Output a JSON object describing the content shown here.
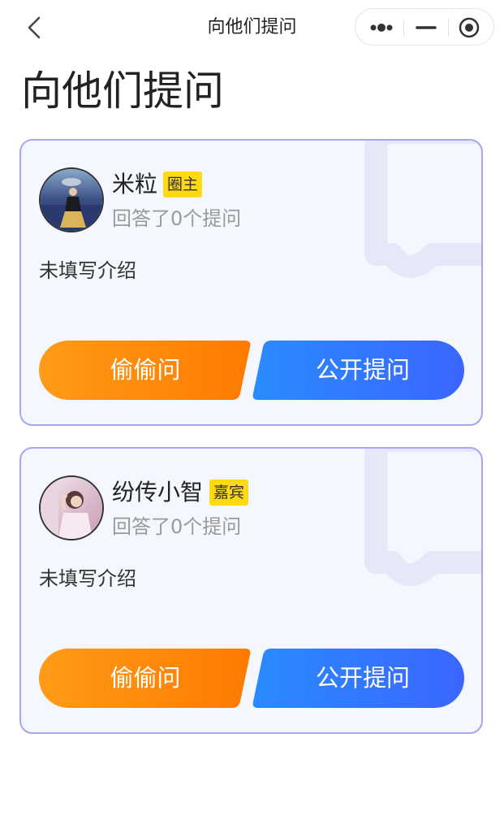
{
  "navbar": {
    "title": "向他们提问",
    "back_icon": "chevron-left-icon",
    "capsule": {
      "more_icon": "more-dots-icon",
      "minimize_icon": "minimize-icon",
      "close_icon": "target-circle-icon"
    }
  },
  "page": {
    "title": "向他们提问"
  },
  "cards": [
    {
      "name": "米粒",
      "role": "圈主",
      "answers": "回答了0个提问",
      "intro": "未填写介绍",
      "secret_button": "偷偷问",
      "public_button": "公开提问"
    },
    {
      "name": "纷传小智",
      "role": "嘉宾",
      "answers": "回答了0个提问",
      "intro": "未填写介绍",
      "secret_button": "偷偷问",
      "public_button": "公开提问"
    }
  ],
  "colors": {
    "card_border": "#a7a6ef",
    "card_bg": "#f4f7fd",
    "badge_bg": "#ffd912",
    "secret_gradient": [
      "#ff9b17",
      "#ff7a00"
    ],
    "public_gradient": [
      "#2a8bff",
      "#3a66ff"
    ]
  }
}
